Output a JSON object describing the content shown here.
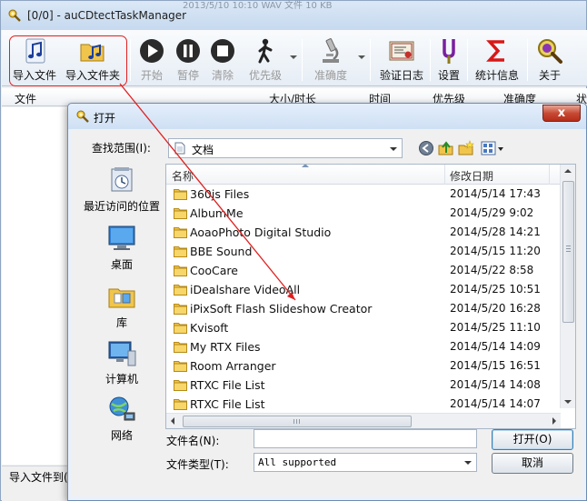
{
  "main_window": {
    "title": "[0/0] - auCDtectTaskManager",
    "title_ghost": "2013/5/10 10:10        WAV 文件                          10 KB",
    "status_text": "导入文件到(",
    "list_columns": [
      "文件",
      "大小/时长",
      "时间",
      "优先级",
      "准确度",
      "状"
    ]
  },
  "toolbar": {
    "buttons": [
      {
        "label": "导入文件",
        "icon": "music-note-icon",
        "enabled": true
      },
      {
        "label": "导入文件夹",
        "icon": "music-folder-icon",
        "enabled": true
      },
      {
        "label": "开始",
        "icon": "play-icon",
        "enabled": false
      },
      {
        "label": "暂停",
        "icon": "pause-icon",
        "enabled": false
      },
      {
        "label": "清除",
        "icon": "stop-icon",
        "enabled": false
      },
      {
        "label": "优先级",
        "icon": "walking-person-icon",
        "enabled": false
      },
      {
        "label": "准确度",
        "icon": "microscope-icon",
        "enabled": false
      },
      {
        "label": "验证日志",
        "icon": "certificate-icon",
        "enabled": true
      },
      {
        "label": "设置",
        "icon": "tuning-fork-icon",
        "enabled": true
      },
      {
        "label": "统计信息",
        "icon": "sigma-icon",
        "enabled": true
      },
      {
        "label": "关于",
        "icon": "magnifier-icon",
        "enabled": true
      }
    ]
  },
  "dialog": {
    "title": "打开",
    "close_label": "x",
    "look_in_label": "查找范围(I):",
    "look_in_value": "文档",
    "places": [
      {
        "label": "最近访问的位置",
        "icon": "recent-places-icon"
      },
      {
        "label": "桌面",
        "icon": "desktop-icon"
      },
      {
        "label": "库",
        "icon": "libraries-icon"
      },
      {
        "label": "计算机",
        "icon": "computer-icon"
      },
      {
        "label": "网络",
        "icon": "network-icon"
      }
    ],
    "columns": {
      "name": "名称",
      "modified": "修改日期"
    },
    "files": [
      {
        "name": "360js Files",
        "date": "2014/5/14 17:43"
      },
      {
        "name": "AlbumMe",
        "date": "2014/5/29 9:02"
      },
      {
        "name": "AoaoPhoto Digital Studio",
        "date": "2014/5/28 14:21"
      },
      {
        "name": "BBE Sound",
        "date": "2014/5/15 11:20"
      },
      {
        "name": "CooCare",
        "date": "2014/5/22 8:58"
      },
      {
        "name": "iDealshare VideoAll",
        "date": "2014/5/25 10:51"
      },
      {
        "name": "iPixSoft Flash Slideshow Creator",
        "date": "2014/5/20 16:28"
      },
      {
        "name": "Kvisoft",
        "date": "2014/5/25 11:10"
      },
      {
        "name": "My RTX Files",
        "date": "2014/5/14 14:09"
      },
      {
        "name": "Room Arranger",
        "date": "2014/5/15 16:51"
      },
      {
        "name": "RTXC File List",
        "date": "2014/5/14 14:08"
      },
      {
        "name": "RTXC File List",
        "date": "2014/5/14 14:07"
      }
    ],
    "filename_label": "文件名(N):",
    "filename_value": "",
    "filetype_label": "文件类型(T):",
    "filetype_value": "All supported",
    "open_button": "打开(O)",
    "cancel_button": "取消"
  }
}
